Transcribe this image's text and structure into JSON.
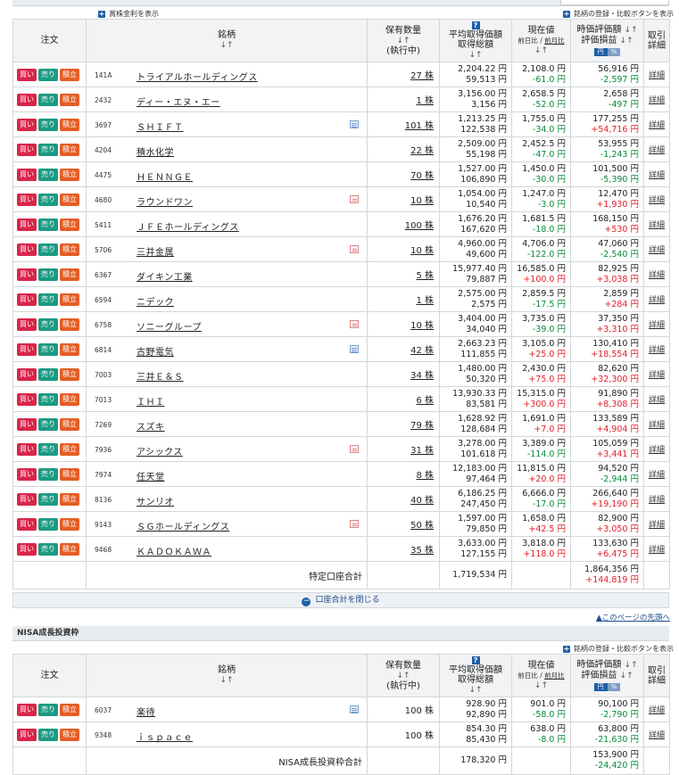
{
  "links": {
    "dividends": "賞株金利を表示",
    "register": "銘柄の登録・比較ボタンを表示"
  },
  "header": {
    "order": "注文",
    "brand": "銘柄",
    "holdings": "保有数量",
    "executing": "(執行中)",
    "avg_price": "平均取得価額",
    "total_cost": "取得総額",
    "current": "現在値",
    "prev_day": "前日比",
    "slash": " / ",
    "prev_month": "前月比",
    "valuation": "時価評価額",
    "pl": "評価損益",
    "yen": "円",
    "pct": "%",
    "trade": "取引",
    "detail": "詳細",
    "sort": "↓↑"
  },
  "buttons": {
    "buy": "買い",
    "sell": "売り",
    "accumulate": "積立",
    "detail": "詳細"
  },
  "tokutei": {
    "rows": [
      {
        "code": "141A",
        "name": "トライアルホールディングス",
        "qty": "27 株",
        "icon": "",
        "avg": "2,204.22 円",
        "total": "59,513 円",
        "price": "2,108.0 円",
        "chg": "-61.0 円",
        "val": "56,916 円",
        "pl": "-2,597 円"
      },
      {
        "code": "2432",
        "name": "ディー・エヌ・エー",
        "qty": "1 株",
        "icon": "",
        "avg": "3,156.00 円",
        "total": "3,156 円",
        "price": "2,658.5 円",
        "chg": "-52.0 円",
        "val": "2,658 円",
        "pl": "-497 円"
      },
      {
        "code": "3697",
        "name": "ＳＨＩＦＴ",
        "qty": "101 株",
        "icon": "calendar",
        "avg": "1,213.25 円",
        "total": "122,538 円",
        "price": "1,755.0 円",
        "chg": "-34.0 円",
        "val": "177,255 円",
        "pl": "+54,716 円"
      },
      {
        "code": "4204",
        "name": "積水化学",
        "qty": "22 株",
        "icon": "",
        "avg": "2,509.00 円",
        "total": "55,198 円",
        "price": "2,452.5 円",
        "chg": "-47.0 円",
        "val": "53,955 円",
        "pl": "-1,243 円"
      },
      {
        "code": "4475",
        "name": "ＨＥＮＮＧＥ",
        "qty": "70 株",
        "icon": "",
        "avg": "1,527.00 円",
        "total": "106,890 円",
        "price": "1,450.0 円",
        "chg": "-30.0 円",
        "val": "101,500 円",
        "pl": "-5,390 円"
      },
      {
        "code": "4680",
        "name": "ラウンドワン",
        "qty": "10 株",
        "icon": "news",
        "avg": "1,054.00 円",
        "total": "10,540 円",
        "price": "1,247.0 円",
        "chg": "-3.0 円",
        "val": "12,470 円",
        "pl": "+1,930 円"
      },
      {
        "code": "5411",
        "name": "ＪＦＥホールディングス",
        "qty": "100 株",
        "icon": "",
        "avg": "1,676.20 円",
        "total": "167,620 円",
        "price": "1,681.5 円",
        "chg": "-18.0 円",
        "val": "168,150 円",
        "pl": "+530 円"
      },
      {
        "code": "5706",
        "name": "三井金属",
        "qty": "10 株",
        "icon": "news",
        "avg": "4,960.00 円",
        "total": "49,600 円",
        "price": "4,706.0 円",
        "chg": "-122.0 円",
        "val": "47,060 円",
        "pl": "-2,540 円"
      },
      {
        "code": "6367",
        "name": "ダイキン工業",
        "qty": "5 株",
        "icon": "",
        "avg": "15,977.40 円",
        "total": "79,887 円",
        "price": "16,585.0 円",
        "chg": "+100.0 円",
        "val": "82,925 円",
        "pl": "+3,038 円"
      },
      {
        "code": "6594",
        "name": "ニデック",
        "qty": "1 株",
        "icon": "",
        "avg": "2,575.00 円",
        "total": "2,575 円",
        "price": "2,859.5 円",
        "chg": "-17.5 円",
        "val": "2,859 円",
        "pl": "+284 円"
      },
      {
        "code": "6758",
        "name": "ソニーグループ",
        "qty": "10 株",
        "icon": "news",
        "avg": "3,404.00 円",
        "total": "34,040 円",
        "price": "3,735.0 円",
        "chg": "-39.0 円",
        "val": "37,350 円",
        "pl": "+3,310 円"
      },
      {
        "code": "6814",
        "name": "古野電気",
        "qty": "42 株",
        "icon": "calendar",
        "avg": "2,663.23 円",
        "total": "111,855 円",
        "price": "3,105.0 円",
        "chg": "+25.0 円",
        "val": "130,410 円",
        "pl": "+18,554 円"
      },
      {
        "code": "7003",
        "name": "三井Ｅ＆Ｓ",
        "qty": "34 株",
        "icon": "",
        "avg": "1,480.00 円",
        "total": "50,320 円",
        "price": "2,430.0 円",
        "chg": "+75.0 円",
        "val": "82,620 円",
        "pl": "+32,300 円"
      },
      {
        "code": "7013",
        "name": "ＩＨＩ",
        "qty": "6 株",
        "icon": "",
        "avg": "13,930.33 円",
        "total": "83,581 円",
        "price": "15,315.0 円",
        "chg": "+300.0 円",
        "val": "91,890 円",
        "pl": "+8,308 円"
      },
      {
        "code": "7269",
        "name": "スズキ",
        "qty": "79 株",
        "icon": "",
        "avg": "1,628.92 円",
        "total": "128,684 円",
        "price": "1,691.0 円",
        "chg": "+7.0 円",
        "val": "133,589 円",
        "pl": "+4,904 円"
      },
      {
        "code": "7936",
        "name": "アシックス",
        "qty": "31 株",
        "icon": "news",
        "avg": "3,278.00 円",
        "total": "101,618 円",
        "price": "3,389.0 円",
        "chg": "-114.0 円",
        "val": "105,059 円",
        "pl": "+3,441 円"
      },
      {
        "code": "7974",
        "name": "任天堂",
        "qty": "8 株",
        "icon": "",
        "avg": "12,183.00 円",
        "total": "97,464 円",
        "price": "11,815.0 円",
        "chg": "+20.0 円",
        "val": "94,520 円",
        "pl": "-2,944 円"
      },
      {
        "code": "8136",
        "name": "サンリオ",
        "qty": "40 株",
        "icon": "",
        "avg": "6,186.25 円",
        "total": "247,450 円",
        "price": "6,666.0 円",
        "chg": "-17.0 円",
        "val": "266,640 円",
        "pl": "+19,190 円"
      },
      {
        "code": "9143",
        "name": "ＳＧホールディングス",
        "qty": "50 株",
        "icon": "news",
        "avg": "1,597.00 円",
        "total": "79,850 円",
        "price": "1,658.0 円",
        "chg": "+42.5 円",
        "val": "82,900 円",
        "pl": "+3,050 円"
      },
      {
        "code": "9468",
        "name": "ＫＡＤＯＫＡＷＡ",
        "qty": "35 株",
        "icon": "",
        "avg": "3,633.00 円",
        "total": "127,155 円",
        "price": "3,818.0 円",
        "chg": "+118.0 円",
        "val": "133,630 円",
        "pl": "+6,475 円"
      }
    ],
    "total_label": "特定口座合計",
    "total_cost": "1,719,534 円",
    "total_val": "1,864,356 円",
    "total_pl": "+144,819 円"
  },
  "close_label": "口座合計を閉じる",
  "page_top": "▲このページの先頭へ",
  "nisa": {
    "title": "NISA成長投資枠",
    "rows": [
      {
        "code": "6037",
        "name": "楽待",
        "qty": "100 株",
        "icon": "calendar",
        "avg": "928.90 円",
        "total": "92,890 円",
        "price": "901.0 円",
        "chg": "-58.0 円",
        "val": "90,100 円",
        "pl": "-2,790 円"
      },
      {
        "code": "9348",
        "name": "ｉｓｐａｃｅ",
        "qty": "100 株",
        "icon": "",
        "avg": "854.30 円",
        "total": "85,430 円",
        "price": "638.0 円",
        "chg": "-8.0 円",
        "val": "63,800 円",
        "pl": "-21,630 円"
      }
    ],
    "total_label": "NISA成長投資枠合計",
    "total_cost": "178,320 円",
    "total_val": "153,900 円",
    "total_pl": "-24,420 円"
  },
  "colors": {
    "buy": "#d9254a",
    "sell": "#1b9a83",
    "accumulate": "#e45d24",
    "positive": "#e0202a",
    "negative": "#0a8a3a"
  }
}
